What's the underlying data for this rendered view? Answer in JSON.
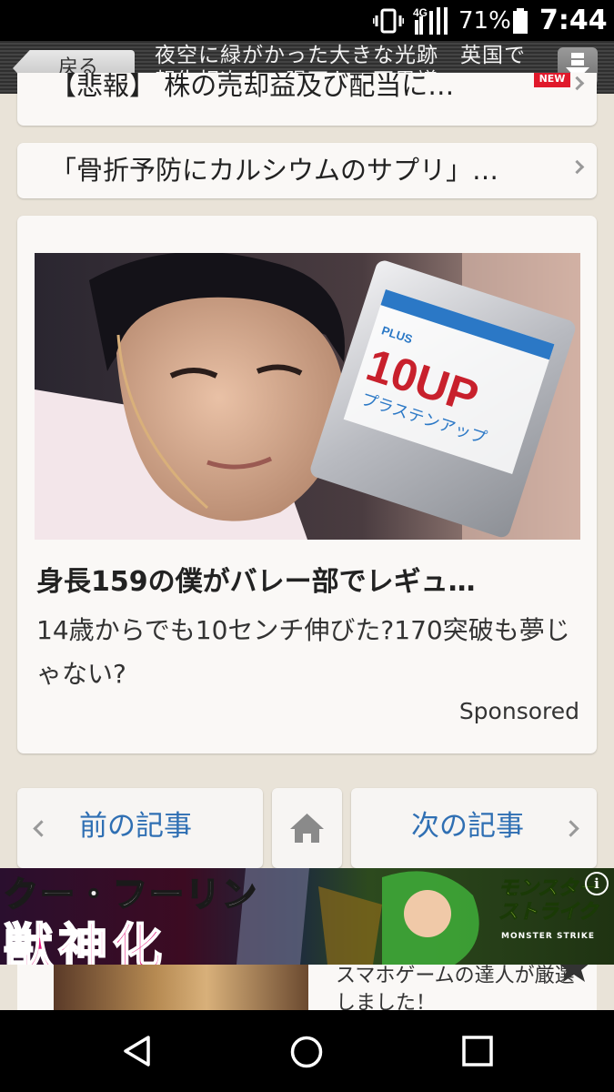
{
  "status_bar": {
    "network": "4G",
    "battery_percent": "71%",
    "time": "7:44"
  },
  "header": {
    "back_label": "戻る",
    "title": "夜空に緑がかった大きな光跡　英国で報告相次ぐ　隕石か：不思議"
  },
  "articles": {
    "partial_item": {
      "label": "【悲報】 株の売却益及び配当に…",
      "badge": "NEW"
    },
    "item": {
      "label": "「骨折予防にカルシウムのサプリ」…"
    }
  },
  "sponsored": {
    "title": "身長159の僕がバレー部でレギュ…",
    "body": "14歳からでも10センチ伸びた?170突破も夢じゃない?",
    "sponsored_label": "Sponsored",
    "product_text": {
      "plus": "PLUS",
      "name": "10UP",
      "kana": "プラステンアップ"
    }
  },
  "navigation": {
    "prev_label": "前の記事",
    "next_label": "次の記事"
  },
  "banner_ad": {
    "line1": "クー・フーリン",
    "line2": "獣神化",
    "logo": "モンスター ストライク",
    "logo_sub": "MONSTER STRIKE",
    "info": "i"
  },
  "bottom_ad": {
    "text": "スマホゲームの達人が厳選しました！"
  },
  "colors": {
    "link_blue": "#2f6fb3",
    "badge_red": "#e0192b",
    "banner_magenta": "#e3187d",
    "background": "#e9e3d8"
  },
  "icons": [
    "vibrate-icon",
    "signal-icon",
    "battery-icon",
    "download-icon",
    "chevron-right-icon",
    "chevron-left-icon",
    "home-icon",
    "info-icon",
    "star-icon",
    "back-triangle-icon",
    "home-circle-icon",
    "recents-square-icon"
  ]
}
